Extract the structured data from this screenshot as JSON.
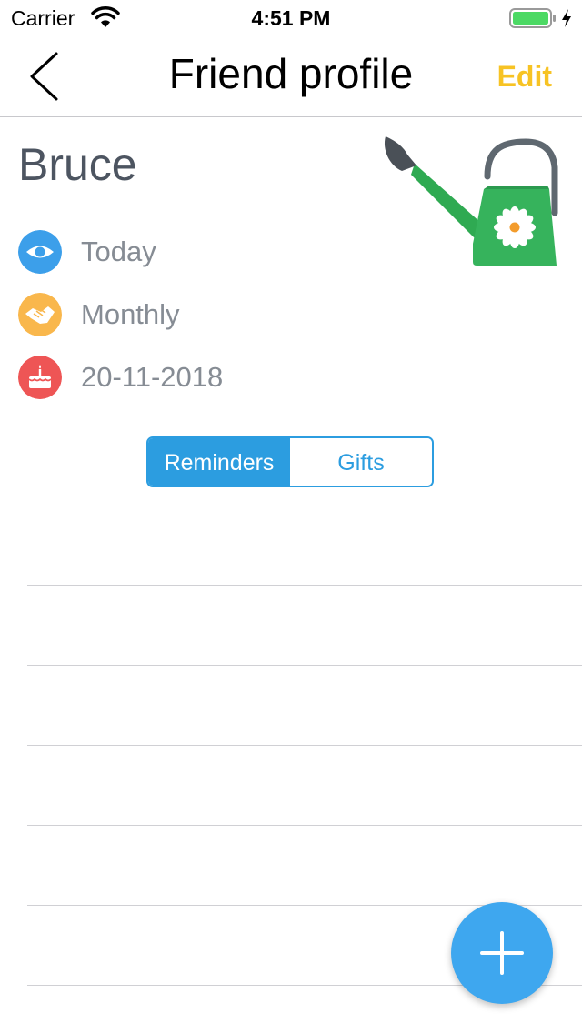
{
  "status_bar": {
    "carrier": "Carrier",
    "time": "4:51 PM",
    "wifi_icon": "wifi-icon",
    "battery_icon": "battery-icon",
    "charging_icon": "bolt-icon",
    "battery_color": "#4cd964"
  },
  "nav": {
    "title": "Friend profile",
    "back_icon": "chevron-left-icon",
    "edit_label": "Edit",
    "edit_color": "#f7c324"
  },
  "profile": {
    "name": "Bruce",
    "avatar_icon": "watering-can-icon",
    "info": [
      {
        "icon": "eye-icon",
        "color": "#3c9fea",
        "text": "Today"
      },
      {
        "icon": "handshake-icon",
        "color": "#f9b74c",
        "text": "Monthly"
      },
      {
        "icon": "birthday-cake-icon",
        "color": "#ee5555",
        "text": "20-11-2018"
      }
    ]
  },
  "tabs": [
    {
      "label": "Reminders",
      "selected": true
    },
    {
      "label": "Gifts",
      "selected": false
    }
  ],
  "fab": {
    "icon": "plus-icon",
    "color": "#3ea7ef"
  }
}
